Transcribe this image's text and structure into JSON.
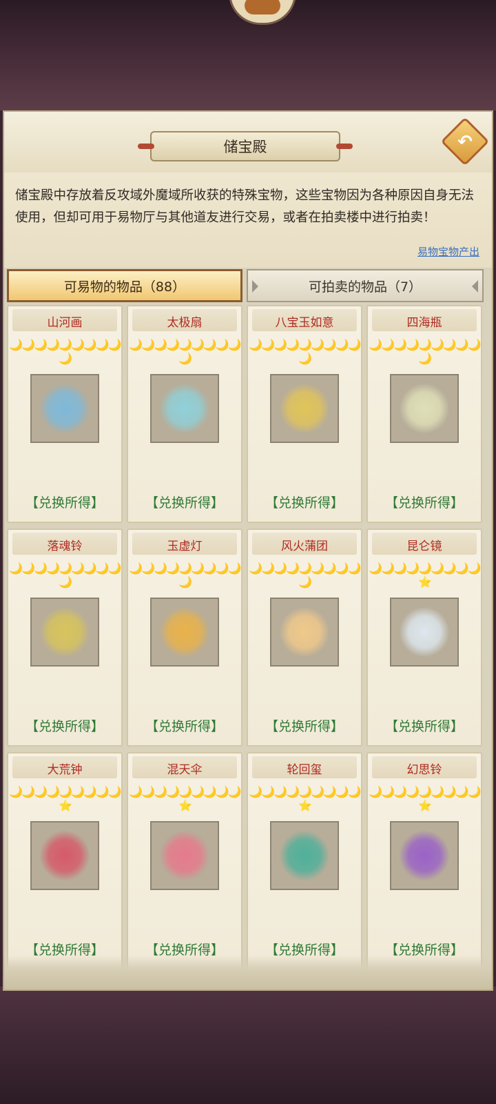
{
  "panel": {
    "title": "储宝殿",
    "description": "储宝殿中存放着反攻域外魔域所收获的特殊宝物，这些宝物因为各种原因自身无法使用，但却可用于易物厅与其他道友进行交易，或者在拍卖楼中进行拍卖！",
    "link": "易物宝物产出",
    "back_icon": "back-arrow-icon"
  },
  "tabs": [
    {
      "label": "可易物的物品（88）",
      "active": true
    },
    {
      "label": "可拍卖的物品（7）",
      "active": false
    }
  ],
  "items": [
    {
      "name": "山河画",
      "stars": "🌙🌙🌙🌙🌙🌙🌙🌙🌙🌙",
      "action": "【兑换所得】",
      "color": "#7fb9d9"
    },
    {
      "name": "太极扇",
      "stars": "🌙🌙🌙🌙🌙🌙🌙🌙🌙🌙",
      "action": "【兑换所得】",
      "color": "#8fd0d8"
    },
    {
      "name": "八宝玉如意",
      "stars": "🌙🌙🌙🌙🌙🌙🌙🌙🌙🌙",
      "action": "【兑换所得】",
      "color": "#e1c45a"
    },
    {
      "name": "四海瓶",
      "stars": "🌙🌙🌙🌙🌙🌙🌙🌙🌙🌙",
      "action": "【兑换所得】",
      "color": "#dfe0b8"
    },
    {
      "name": "落魂铃",
      "stars": "🌙🌙🌙🌙🌙🌙🌙🌙🌙🌙",
      "action": "【兑换所得】",
      "color": "#d8c45c"
    },
    {
      "name": "玉虚灯",
      "stars": "🌙🌙🌙🌙🌙🌙🌙🌙🌙🌙",
      "action": "【兑换所得】",
      "color": "#e9b24a"
    },
    {
      "name": "风火蒲团",
      "stars": "🌙🌙🌙🌙🌙🌙🌙🌙🌙🌙",
      "action": "【兑换所得】",
      "color": "#f0c98a"
    },
    {
      "name": "昆仑镜",
      "stars": "🌙🌙🌙🌙🌙🌙🌙🌙🌙⭐",
      "action": "【兑换所得】",
      "color": "#dde7ee"
    },
    {
      "name": "大荒钟",
      "stars": "🌙🌙🌙🌙🌙🌙🌙🌙🌙⭐",
      "action": "【兑换所得】",
      "color": "#d65a6a"
    },
    {
      "name": "混天伞",
      "stars": "🌙🌙🌙🌙🌙🌙🌙🌙🌙⭐",
      "action": "【兑换所得】",
      "color": "#e67a8c"
    },
    {
      "name": "轮回玺",
      "stars": "🌙🌙🌙🌙🌙🌙🌙🌙🌙⭐",
      "action": "【兑换所得】",
      "color": "#4fb09a"
    },
    {
      "name": "幻思铃",
      "stars": "🌙🌙🌙🌙🌙🌙🌙🌙🌙⭐",
      "action": "【兑换所得】",
      "color": "#9a62c8"
    }
  ]
}
